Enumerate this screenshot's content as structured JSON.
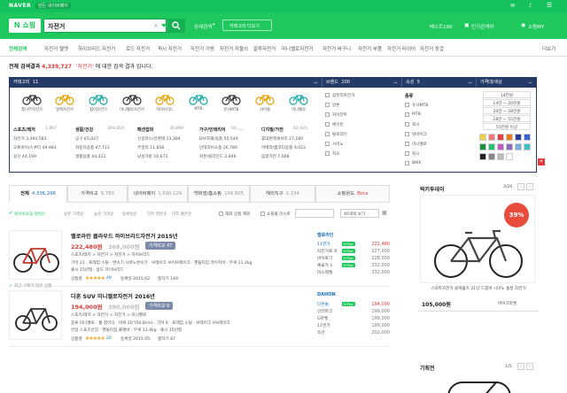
{
  "topbar": {
    "brand": "NAVER",
    "my_link": "만든 네이버페이"
  },
  "header": {
    "logo": "N 쇼핑",
    "search": {
      "value": "자전거"
    },
    "detail_search": "상세검색",
    "voice_search": "카테고리 더보기",
    "best100": "베스트100",
    "event": "인기검색어",
    "user": "쇼핑MY"
  },
  "categories": [
    "전체검색",
    "자전거 헬멧",
    "하이브리드 자전거",
    "로드 자전거",
    "픽시 자전거",
    "자전거 거방",
    "자전거 자물쇠",
    "알루자전거",
    "미니벨로자전거",
    "자전거 바구니",
    "자전거 부품",
    "자전거 타이어",
    "자전거 장갑",
    "더보기"
  ],
  "result": {
    "prefix": "전체 검색결과",
    "count": "4,339,727",
    "term": "'자전거'",
    "suffix": "에 대한 검색 결과 입니다."
  },
  "filter": {
    "category_title": "카테고리",
    "category_count": "11",
    "brand_title": "브랜드",
    "brand_count": "200",
    "attr_title": "속성",
    "attr_count": "5",
    "price_title": "가격대/색상",
    "bike_labels": [
      "통나무자전거",
      "일렉자전거",
      "접이자전거",
      "미니벨로자전거",
      "하이브리드",
      "MTB",
      "유사MTB",
      "사이클",
      "미니벨로"
    ],
    "groups": [
      {
        "title": "스포츠/레저",
        "count": "1,807",
        "items": [
          "자전거 3,494,583",
          "오토바이/스쿠터 49,983",
          "용산 44,199"
        ]
      },
      {
        "title": "생활/건강",
        "count": "369,854",
        "items": [
          "공구 65,027",
          "자동차용품 67,713",
          "생활용품 44,422"
        ]
      },
      {
        "title": "패션잡화",
        "count": "36,898",
        "items": [
          "선글라스/안경테 13,384",
          "주얼리 11,858",
          "남성가방 10,673"
        ]
      },
      {
        "title": "가구/인테리어",
        "count": "60,___",
        "items": [
          "DIY자재/용품 55,549",
          "인테리어소품 26,780",
          "커튼/블라인드 2,846"
        ]
      },
      {
        "title": "디지털/가전",
        "count": "62,925",
        "items": [
          "휴대폰액세서리 27,280",
          "카메라/캠코더용품 9,023",
          "음향가전 7,668"
        ]
      }
    ],
    "brands": [
      "삼천리자전거",
      "알톤",
      "자이언트",
      "에이틴",
      "빌로라인",
      "시미노",
      "지오"
    ],
    "attrs": [
      "종류",
      "유사MTB",
      "MTB",
      "픽시",
      "멋바이크",
      "미니벨로",
      "픽시",
      "BMX"
    ],
    "prices": [
      "14만원",
      "14만 ~ 20만원",
      "20만 ~ 28만원",
      "28만 ~ 55만원",
      "55만원 이상"
    ],
    "colors": [
      "#e8d24a",
      "#f07a7a",
      "#e24242",
      "#e67e22",
      "#2c3e96",
      "#3a5fcf",
      "#1b8f3a",
      "#2dbd6e",
      "#c05bbf",
      "#8a6bbd",
      "#7ab0e0",
      "#3fbfbf",
      "#222222",
      "#888888",
      "#bbbbbb",
      "#ffffff"
    ]
  },
  "tabs": [
    {
      "label": "전체",
      "count": "4,336,296"
    },
    {
      "label": "가격비교",
      "count": "9,789"
    },
    {
      "label": "네이버페이",
      "count": "1,590,129"
    },
    {
      "label": "백화점/홈쇼핑",
      "count": "104,805"
    },
    {
      "label": "해외직구",
      "count": "2,334"
    },
    {
      "label": "쇼핑윈도",
      "count": "Beta"
    }
  ],
  "options": {
    "npay": "네이버쇼핑 랭킹순",
    "sorts": [
      "낮은 가격순",
      "높은 가격순",
      "등록일순",
      "리뷰 많은순",
      "리뷰 좋은순"
    ],
    "check1": "해외 상품 제외",
    "check2": "쇼핑몰 리스트",
    "view": "40개씩 보기"
  },
  "products": [
    {
      "title": "벨로라인 클라우드 하이브리드자전거 2015년",
      "price": "222,480원",
      "price2": "368,000원",
      "badge": "가격비교 47",
      "cats": "스포츠/레저  >  자전거  >  자전거  >  하이브리드",
      "spec1": "기어 21 · 프레임 스틸 · 변속기 시마노변속기 · 브레이크 브이브레이크 · 핸들타입 라이저바 · 무게 11.2kg",
      "spec2": "출시 15년형 · 용도 하이브리드",
      "rating": "상품평",
      "reviews": "49",
      "reg": "등록일 2015.02.",
      "zzim": "찜하기 149",
      "mall_brand": "벨로라인",
      "malls": [
        [
          "11번가",
          "222,480"
        ],
        [
          "자전거로 호",
          "227,000"
        ],
        [
          "바이로기",
          "228,000"
        ],
        [
          "예술가 1",
          "232,000"
        ],
        [
          "미스제월",
          "232,000"
        ]
      ],
      "note": "최근 구매가 많은 상품"
    },
    {
      "title": "다혼 SUV 미니벨로자전거 2016년",
      "price": "194,000원",
      "price2": "390,000원",
      "badge": "가격비교 9",
      "cats": "스포츠/레저  >  자전거  >  자전거  >  미니벨로",
      "spec1": "종류 미니벨로 · 휠 접이식 · 바퀴 20\"(50.8cm) · 기어 6 · 프레임 스틸 · 브레이크 V브레이크",
      "spec2": "안장 스포츠안장 · 핸들타입 플랫바 · 무게 13.4kg · 출시 15년형",
      "rating": "상품평",
      "reviews": "20",
      "reg": "등록일 2015.05.",
      "zzim": "찜하기 87",
      "mall_brand": "DAHON",
      "malls": [
        [
          "다혼몰",
          "194,000"
        ],
        [
          "인터파크",
          "199,000"
        ],
        [
          "G마켓",
          "199,000"
        ],
        [
          "11번가",
          "199,000"
        ],
        [
          "옥션",
          "202,000"
        ]
      ]
    }
  ],
  "side": {
    "title": "럭키투데이",
    "page": "3/20",
    "discount": "39%",
    "desc": "스마트자전거 블랙홀츠 21단 드롭바 시마노 통풍 자전거",
    "price": "105,000원",
    "mall": "바이크마켓",
    "title2": "기획전",
    "page2": "1/5"
  }
}
